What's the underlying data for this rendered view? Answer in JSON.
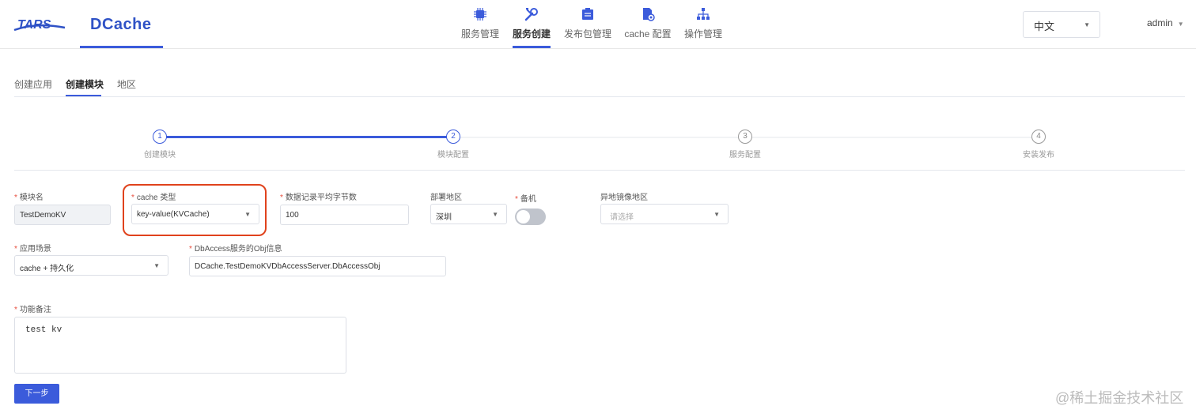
{
  "brand": {
    "tars": "TARS",
    "dcache": "DCache"
  },
  "nav": [
    {
      "label": "服务管理",
      "icon": "chip-icon"
    },
    {
      "label": "服务创建",
      "icon": "wrench-icon"
    },
    {
      "label": "发布包管理",
      "icon": "package-icon"
    },
    {
      "label": "cache 配置",
      "icon": "config-icon"
    },
    {
      "label": "操作管理",
      "icon": "hierarchy-icon"
    }
  ],
  "header": {
    "language": "中文",
    "user": "admin"
  },
  "tabs": [
    "创建应用",
    "创建模块",
    "地区"
  ],
  "steps": [
    {
      "num": "1",
      "label": "创建模块"
    },
    {
      "num": "2",
      "label": "模块配置"
    },
    {
      "num": "3",
      "label": "服务配置"
    },
    {
      "num": "4",
      "label": "安装发布"
    }
  ],
  "form": {
    "module_name_label": "模块名",
    "module_name_value": "TestDemoKV",
    "cache_type_label": "cache 类型",
    "cache_type_value": "key-value(KVCache)",
    "avg_bytes_label": "数据记录平均字节数",
    "avg_bytes_value": "100",
    "region_label": "部署地区",
    "region_value": "深圳",
    "backup_label": "备机",
    "remote_region_label": "异地镜像地区",
    "remote_region_placeholder": "请选择",
    "scenario_label": "应用场景",
    "scenario_value": "cache + 持久化",
    "dbaccess_label": "DbAccess服务的Obj信息",
    "dbaccess_value": "DCache.TestDemoKVDbAccessServer.DbAccessObj",
    "remark_label": "功能备注",
    "remark_value": "test kv",
    "next_button": "下一步"
  },
  "watermark": "@稀土掘金技术社区",
  "colors": {
    "accent": "#3b5bdb",
    "highlight": "#e0421c",
    "required": "#e74c3c"
  }
}
